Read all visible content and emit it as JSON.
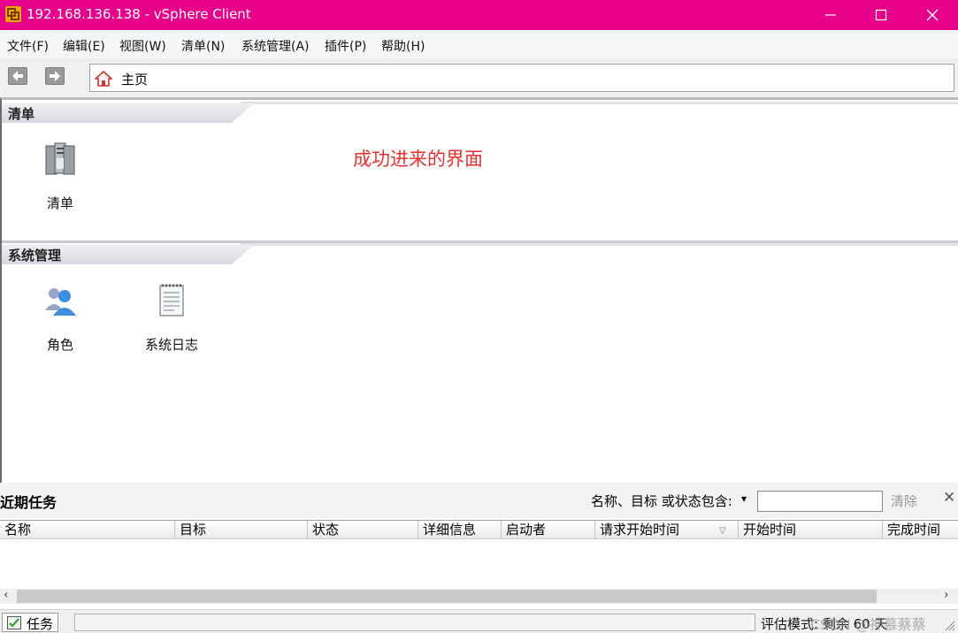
{
  "window": {
    "title": "192.168.136.138 - vSphere Client",
    "controls": {
      "min_icon": "minimize-icon",
      "max_icon": "maximize-icon",
      "close_icon": "close-icon"
    }
  },
  "menu": [
    "文件(F)",
    "编辑(E)",
    "视图(W)",
    "清单(N)",
    "系统管理(A)",
    "插件(P)",
    "帮助(H)"
  ],
  "nav": {
    "back_icon": "back-arrow-icon",
    "forward_icon": "forward-arrow-icon",
    "home_icon": "home-icon",
    "address_text": "主页"
  },
  "sections": [
    {
      "title": "清单",
      "items": [
        {
          "label": "清单",
          "icon": "inventory-servers-icon"
        }
      ]
    },
    {
      "title": "系统管理",
      "items": [
        {
          "label": "角色",
          "icon": "roles-users-icon"
        },
        {
          "label": "系统日志",
          "icon": "system-log-icon"
        }
      ]
    }
  ],
  "annotation": "成功进来的界面",
  "recent_tasks": {
    "title": "近期任务",
    "filter_label": "名称、目标 或状态包含:",
    "filter_value": "",
    "clear_label": "清除",
    "columns": [
      "名称",
      "目标",
      "状态",
      "详细信息",
      "启动者",
      "请求开始时间",
      "开始时间",
      "完成时间"
    ]
  },
  "status": {
    "tasks_label": "任务",
    "tasks_icon": "tasks-icon",
    "evaluation_text": "评估模式: 剩余 60 天",
    "watermark": "CSDN @神慕蔡蔡"
  },
  "colors": {
    "titlebar": "#e6008a",
    "annotation": "#e8302e"
  }
}
